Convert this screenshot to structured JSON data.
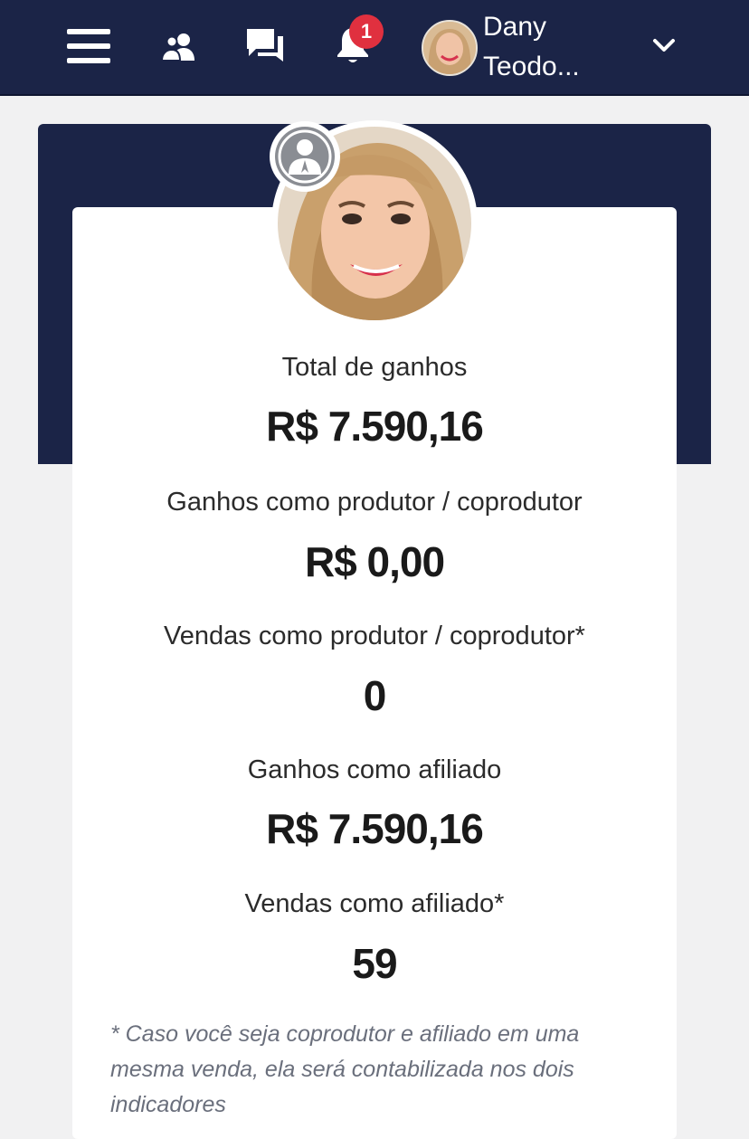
{
  "header": {
    "user_name_line1": "Dany",
    "user_name_line2": "Teodo...",
    "notification_count": "1",
    "icons": [
      "menu-icon",
      "people-icon",
      "chat-icon",
      "bell-icon",
      "chevron-down-icon"
    ],
    "colors": {
      "navbar": "#1b2447",
      "badge": "#e0303f"
    }
  },
  "stats": {
    "total_label": "Total de ganhos",
    "total_value": "R$ 7.590,16",
    "producer_earnings_label": "Ganhos como produtor / coprodutor",
    "producer_earnings_value": "R$ 0,00",
    "producer_sales_label": "Vendas como produtor / coprodutor*",
    "producer_sales_value": "0",
    "affiliate_earnings_label": "Ganhos como afiliado",
    "affiliate_earnings_value": "R$ 7.590,16",
    "affiliate_sales_label": "Vendas como afiliado*",
    "affiliate_sales_value": "59"
  },
  "footnote": "* Caso você seja coprodutor e afiliado em uma mesma venda, ela será contabilizada nos dois indicadores"
}
